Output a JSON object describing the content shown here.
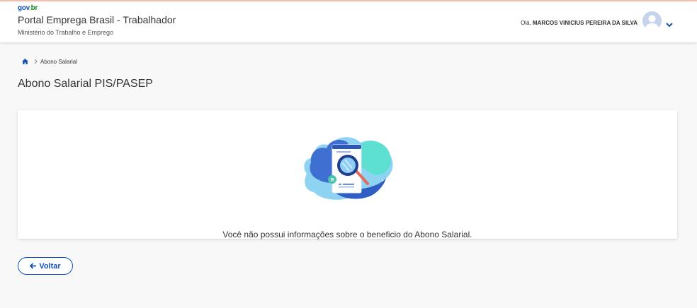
{
  "header": {
    "logo_text": {
      "part1": "gov",
      "part2": ".",
      "part3": "br"
    },
    "app_title": "Portal Emprega Brasil - Trabalhador",
    "app_subtitle": "Ministério do Trabalho e Emprego",
    "greeting_prefix": "Olá,",
    "user_name": "MARCOS VINICIUS PEREIRA DA SILVA"
  },
  "breadcrumb": {
    "home_icon": "home-icon",
    "items": [
      "Abono Salarial"
    ]
  },
  "page": {
    "title": "Abono Salarial PIS/PASEP",
    "empty_message": "Você não possui informações sobre o beneficio do Abono Salarial.",
    "illustration": "document-search-illustration"
  },
  "actions": {
    "back_label": "Voltar"
  },
  "colors": {
    "primary": "#1351b4",
    "background": "#f8f8f8",
    "card": "#ffffff"
  }
}
